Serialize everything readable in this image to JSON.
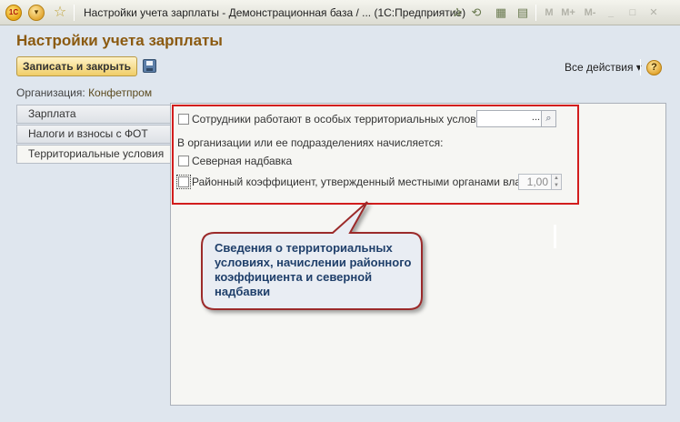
{
  "window": {
    "logo_text": "1С",
    "title": "Настройки учета зарплаты - Демонстрационная база / ...  (1С:Предприятие)",
    "tools": {
      "m": "M",
      "m_plus": "M+",
      "m_minus": "M-"
    }
  },
  "form": {
    "title": "Настройки учета зарплаты",
    "save_close_label": "Записать и закрыть",
    "all_actions_label": "Все действия ▾",
    "help_label": "?",
    "organization_label": "Организация:",
    "organization_value": "Конфетпром"
  },
  "tabs": [
    {
      "label": "Зарплата"
    },
    {
      "label": "Налоги и взносы с ФОТ"
    },
    {
      "label": "Территориальные условия"
    }
  ],
  "territorial": {
    "special_conditions_label": "Сотрудники работают в особых территориальных условиях",
    "special_conditions_value": "",
    "dots": "...",
    "accrued_label": "В организации или ее подразделениях начисляется:",
    "north_bonus_label": "Северная надбавка",
    "district_coef_label": "Районный коэффициент, утвержденный местными органами власти",
    "district_coef_value": "1,00"
  },
  "callout": {
    "text": "Сведения о территориальных условиях, начислении районного коэффициента и северной надбавки"
  },
  "colors": {
    "highlight": "#d21d1d",
    "title_accent": "#8b5a10",
    "callout_text": "#1f3f6a"
  }
}
